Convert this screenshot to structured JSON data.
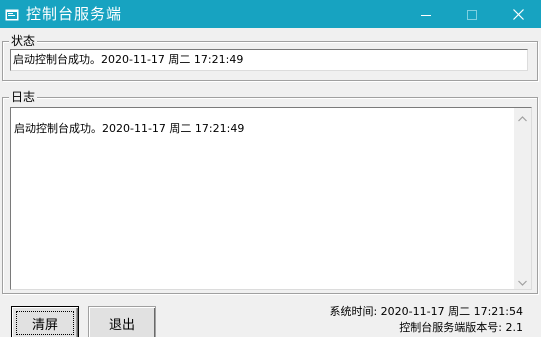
{
  "window": {
    "title": "控制台服务端",
    "accent_color": "#17a3c1",
    "icons": {
      "app": "app-window-icon",
      "minimize": "minimize-icon",
      "maximize": "maximize-icon",
      "close": "close-icon"
    }
  },
  "status_group": {
    "legend": "状态",
    "value": "启动控制台成功。2020-11-17 周二 17:21:49"
  },
  "log_group": {
    "legend": "日志",
    "content": "启动控制台成功。2020-11-17 周二 17:21:49"
  },
  "buttons": {
    "clear_label": "清屏",
    "exit_label": "退出"
  },
  "footer": {
    "system_time_label": "系统时间:",
    "system_time_value": "2020-11-17 周二 17:21:54",
    "version_label": "控制台服务端版本号:",
    "version_value": "2.1"
  }
}
